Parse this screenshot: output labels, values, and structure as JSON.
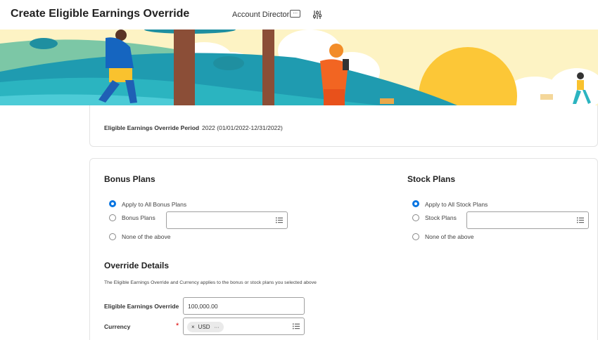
{
  "header": {
    "title": "Create Eligible Earnings Override",
    "role": "Account Director",
    "related_actions_label": "···"
  },
  "period": {
    "label": "Eligible Earnings Override Period",
    "value": "2022 (01/01/2022-12/31/2022)"
  },
  "bonus": {
    "title": "Bonus Plans",
    "options": [
      {
        "label": "Apply to All Bonus Plans",
        "selected": true
      },
      {
        "label": "Bonus Plans",
        "selected": false
      },
      {
        "label": "None of the above",
        "selected": false
      }
    ]
  },
  "stock": {
    "title": "Stock Plans",
    "options": [
      {
        "label": "Apply to All Stock Plans",
        "selected": true
      },
      {
        "label": "Stock Plans",
        "selected": false
      },
      {
        "label": "None of the above",
        "selected": false
      }
    ]
  },
  "override": {
    "title": "Override Details",
    "description": "The Eligible Earnings Override and Currency applies to the bonus or stock plans you selected above",
    "earnings_label": "Eligible Earnings Override",
    "earnings_value": "100,000.00",
    "currency_label": "Currency",
    "required_marker": "*",
    "currency_value": "USD",
    "pill_remove": "×",
    "pill_more": "···"
  },
  "colors": {
    "accent": "#0875e1",
    "required": "#dd0000"
  }
}
